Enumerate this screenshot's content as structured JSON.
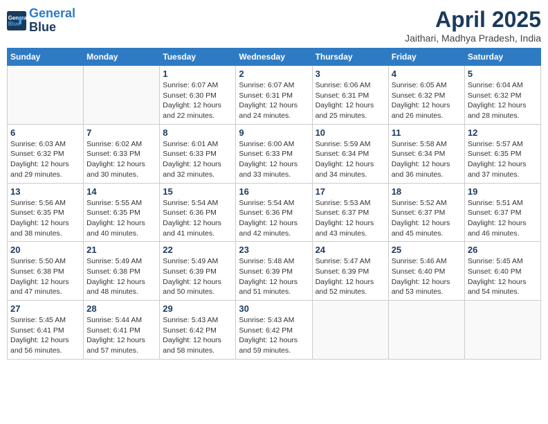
{
  "header": {
    "logo_line1": "General",
    "logo_line2": "Blue",
    "month_title": "April 2025",
    "subtitle": "Jaithari, Madhya Pradesh, India"
  },
  "weekdays": [
    "Sunday",
    "Monday",
    "Tuesday",
    "Wednesday",
    "Thursday",
    "Friday",
    "Saturday"
  ],
  "weeks": [
    [
      {
        "day": "",
        "info": ""
      },
      {
        "day": "",
        "info": ""
      },
      {
        "day": "1",
        "info": "Sunrise: 6:07 AM\nSunset: 6:30 PM\nDaylight: 12 hours and 22 minutes."
      },
      {
        "day": "2",
        "info": "Sunrise: 6:07 AM\nSunset: 6:31 PM\nDaylight: 12 hours and 24 minutes."
      },
      {
        "day": "3",
        "info": "Sunrise: 6:06 AM\nSunset: 6:31 PM\nDaylight: 12 hours and 25 minutes."
      },
      {
        "day": "4",
        "info": "Sunrise: 6:05 AM\nSunset: 6:32 PM\nDaylight: 12 hours and 26 minutes."
      },
      {
        "day": "5",
        "info": "Sunrise: 6:04 AM\nSunset: 6:32 PM\nDaylight: 12 hours and 28 minutes."
      }
    ],
    [
      {
        "day": "6",
        "info": "Sunrise: 6:03 AM\nSunset: 6:32 PM\nDaylight: 12 hours and 29 minutes."
      },
      {
        "day": "7",
        "info": "Sunrise: 6:02 AM\nSunset: 6:33 PM\nDaylight: 12 hours and 30 minutes."
      },
      {
        "day": "8",
        "info": "Sunrise: 6:01 AM\nSunset: 6:33 PM\nDaylight: 12 hours and 32 minutes."
      },
      {
        "day": "9",
        "info": "Sunrise: 6:00 AM\nSunset: 6:33 PM\nDaylight: 12 hours and 33 minutes."
      },
      {
        "day": "10",
        "info": "Sunrise: 5:59 AM\nSunset: 6:34 PM\nDaylight: 12 hours and 34 minutes."
      },
      {
        "day": "11",
        "info": "Sunrise: 5:58 AM\nSunset: 6:34 PM\nDaylight: 12 hours and 36 minutes."
      },
      {
        "day": "12",
        "info": "Sunrise: 5:57 AM\nSunset: 6:35 PM\nDaylight: 12 hours and 37 minutes."
      }
    ],
    [
      {
        "day": "13",
        "info": "Sunrise: 5:56 AM\nSunset: 6:35 PM\nDaylight: 12 hours and 38 minutes."
      },
      {
        "day": "14",
        "info": "Sunrise: 5:55 AM\nSunset: 6:35 PM\nDaylight: 12 hours and 40 minutes."
      },
      {
        "day": "15",
        "info": "Sunrise: 5:54 AM\nSunset: 6:36 PM\nDaylight: 12 hours and 41 minutes."
      },
      {
        "day": "16",
        "info": "Sunrise: 5:54 AM\nSunset: 6:36 PM\nDaylight: 12 hours and 42 minutes."
      },
      {
        "day": "17",
        "info": "Sunrise: 5:53 AM\nSunset: 6:37 PM\nDaylight: 12 hours and 43 minutes."
      },
      {
        "day": "18",
        "info": "Sunrise: 5:52 AM\nSunset: 6:37 PM\nDaylight: 12 hours and 45 minutes."
      },
      {
        "day": "19",
        "info": "Sunrise: 5:51 AM\nSunset: 6:37 PM\nDaylight: 12 hours and 46 minutes."
      }
    ],
    [
      {
        "day": "20",
        "info": "Sunrise: 5:50 AM\nSunset: 6:38 PM\nDaylight: 12 hours and 47 minutes."
      },
      {
        "day": "21",
        "info": "Sunrise: 5:49 AM\nSunset: 6:38 PM\nDaylight: 12 hours and 48 minutes."
      },
      {
        "day": "22",
        "info": "Sunrise: 5:49 AM\nSunset: 6:39 PM\nDaylight: 12 hours and 50 minutes."
      },
      {
        "day": "23",
        "info": "Sunrise: 5:48 AM\nSunset: 6:39 PM\nDaylight: 12 hours and 51 minutes."
      },
      {
        "day": "24",
        "info": "Sunrise: 5:47 AM\nSunset: 6:39 PM\nDaylight: 12 hours and 52 minutes."
      },
      {
        "day": "25",
        "info": "Sunrise: 5:46 AM\nSunset: 6:40 PM\nDaylight: 12 hours and 53 minutes."
      },
      {
        "day": "26",
        "info": "Sunrise: 5:45 AM\nSunset: 6:40 PM\nDaylight: 12 hours and 54 minutes."
      }
    ],
    [
      {
        "day": "27",
        "info": "Sunrise: 5:45 AM\nSunset: 6:41 PM\nDaylight: 12 hours and 56 minutes."
      },
      {
        "day": "28",
        "info": "Sunrise: 5:44 AM\nSunset: 6:41 PM\nDaylight: 12 hours and 57 minutes."
      },
      {
        "day": "29",
        "info": "Sunrise: 5:43 AM\nSunset: 6:42 PM\nDaylight: 12 hours and 58 minutes."
      },
      {
        "day": "30",
        "info": "Sunrise: 5:43 AM\nSunset: 6:42 PM\nDaylight: 12 hours and 59 minutes."
      },
      {
        "day": "",
        "info": ""
      },
      {
        "day": "",
        "info": ""
      },
      {
        "day": "",
        "info": ""
      }
    ]
  ]
}
